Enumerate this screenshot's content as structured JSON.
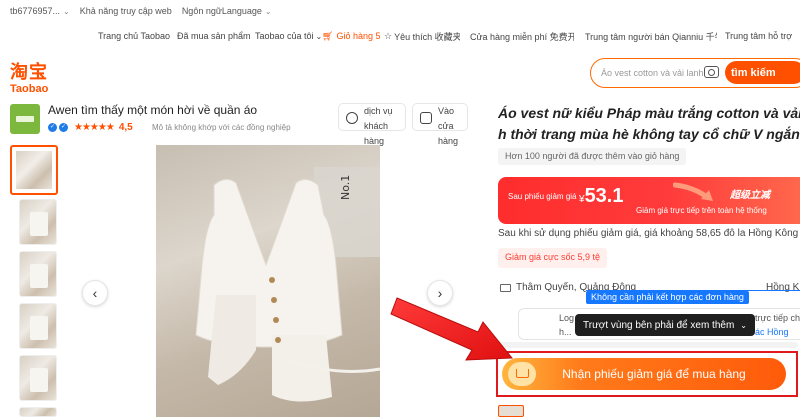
{
  "topbar": {
    "user": "tb6776957...",
    "accessibility": "Khả năng truy cập web",
    "language": "Ngôn ngữLanguage"
  },
  "navbar": {
    "items": [
      "Trang chủ Taobao",
      "Đã mua sản phẩm",
      "Taobao của tôi",
      "Giỏ hàng 5",
      "Yêu thích 收藏夹",
      "Cửa hàng miễn phí 免费开店",
      "Trung tâm người bán Qianniu 千牛卖家中心",
      "Trung tâm hỗ trợ"
    ]
  },
  "logo": {
    "cn": "淘宝",
    "en": "Taobao"
  },
  "search": {
    "placeholder": "Áo vest cotton và vải lanh",
    "button": "tìm kiếm"
  },
  "shop": {
    "name": "Awen tìm thấy một món hời về quần áo",
    "rating": "4,5",
    "stars": "★★★★★",
    "note": "Mô tả không khớp với các đồng nghiệp",
    "customer_service": [
      "dịch vụ",
      "khách",
      "hàng"
    ],
    "visit_store": [
      "Vào",
      "cửa",
      "hàng"
    ]
  },
  "product": {
    "title_line1": "Áo vest nữ kiểu Pháp màu trắng cotton và vải lanh",
    "title_line2": "h thời trang mùa hè không tay cổ chữ V ngắn gọn",
    "added_to_cart": "Hơn 100 người đã được thêm vào giỏ hàng",
    "coupon_label": "Sau phiếu giảm giá",
    "currency": "¥",
    "coupon_price": "53.1",
    "coupon_tag": "超级立减",
    "coupon_sub": "Giảm giá trực tiếp trên toàn hệ thống",
    "after_coupon": "Sau khi sử dụng phiếu giảm giá, giá khoảng 58,65 đô la Hồng Kông",
    "discount_pill": "Giảm giá cực sốc 5,9 tệ",
    "ship_from": "Thâm Quyến, Quảng Đông",
    "ship_to": "Hồng K",
    "blue_tip": "Không cần phải kết hợp các đơn hàng",
    "logistics_a": "Log",
    "logistics_b": "h...",
    "logistics_c": "trực tiếp chí",
    "logistics_d": "ác Hồng",
    "dark_tip": "Trượt vùng bên phải để xem thêm",
    "buy_button": "Nhận phiếu giảm giá để mua hàng"
  },
  "gallery": {
    "prev": "‹",
    "next": "›",
    "number_tag": "No.1"
  },
  "colors": {
    "brand": "#ff5000",
    "coupon_red": "#ff2d2d",
    "highlight_box": "#e0191d",
    "tip_blue": "#1677ff"
  }
}
